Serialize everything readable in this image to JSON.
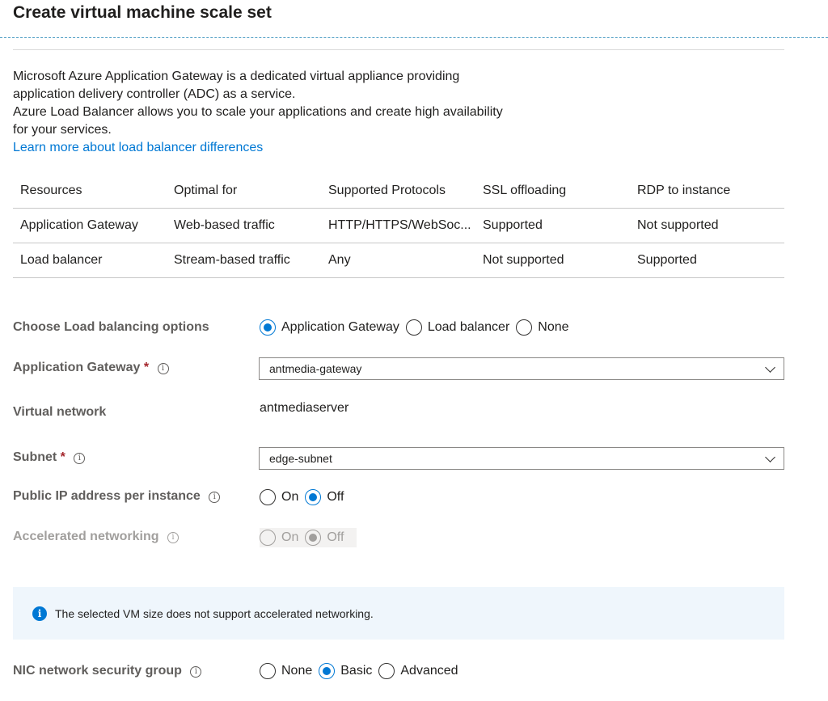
{
  "page": {
    "title": "Create virtual machine scale set"
  },
  "intro": {
    "line1": "Microsoft Azure Application Gateway is a dedicated virtual appliance providing",
    "line2": "application delivery controller (ADC) as a service.",
    "line3": "Azure Load Balancer allows you to scale your applications and create high availability",
    "line4": "for your services.",
    "link": "Learn more about load balancer differences"
  },
  "comparison": {
    "headers": [
      "Resources",
      "Optimal for",
      "Supported Protocols",
      "SSL offloading",
      "RDP to instance"
    ],
    "rows": [
      [
        "Application Gateway",
        "Web-based traffic",
        "HTTP/HTTPS/WebSoc...",
        "Supported",
        "Not supported"
      ],
      [
        "Load balancer",
        "Stream-based traffic",
        "Any",
        "Not supported",
        "Supported"
      ]
    ]
  },
  "lb_options": {
    "label": "Choose Load balancing options",
    "options": [
      "Application Gateway",
      "Load balancer",
      "None"
    ],
    "selected": "Application Gateway"
  },
  "app_gateway": {
    "label": "Application Gateway",
    "required": "*",
    "value": "antmedia-gateway"
  },
  "vnet": {
    "label": "Virtual network",
    "value": "antmediaserver"
  },
  "subnet": {
    "label": "Subnet",
    "required": "*",
    "value": "edge-subnet"
  },
  "public_ip": {
    "label": "Public IP address per instance",
    "options": [
      "On",
      "Off"
    ],
    "selected": "Off"
  },
  "accel": {
    "label": "Accelerated networking",
    "options": [
      "On",
      "Off"
    ],
    "selected": "Off"
  },
  "banner": {
    "text": "The selected VM size does not support accelerated networking."
  },
  "nsg": {
    "label": "NIC network security group",
    "options": [
      "None",
      "Basic",
      "Advanced"
    ],
    "selected": "Basic"
  },
  "icons": {
    "info": "info-icon",
    "chevron": "chevron-down-icon"
  },
  "colors": {
    "accent": "#0078d4",
    "required": "#a4262c",
    "banner_bg": "#eff6fc"
  }
}
